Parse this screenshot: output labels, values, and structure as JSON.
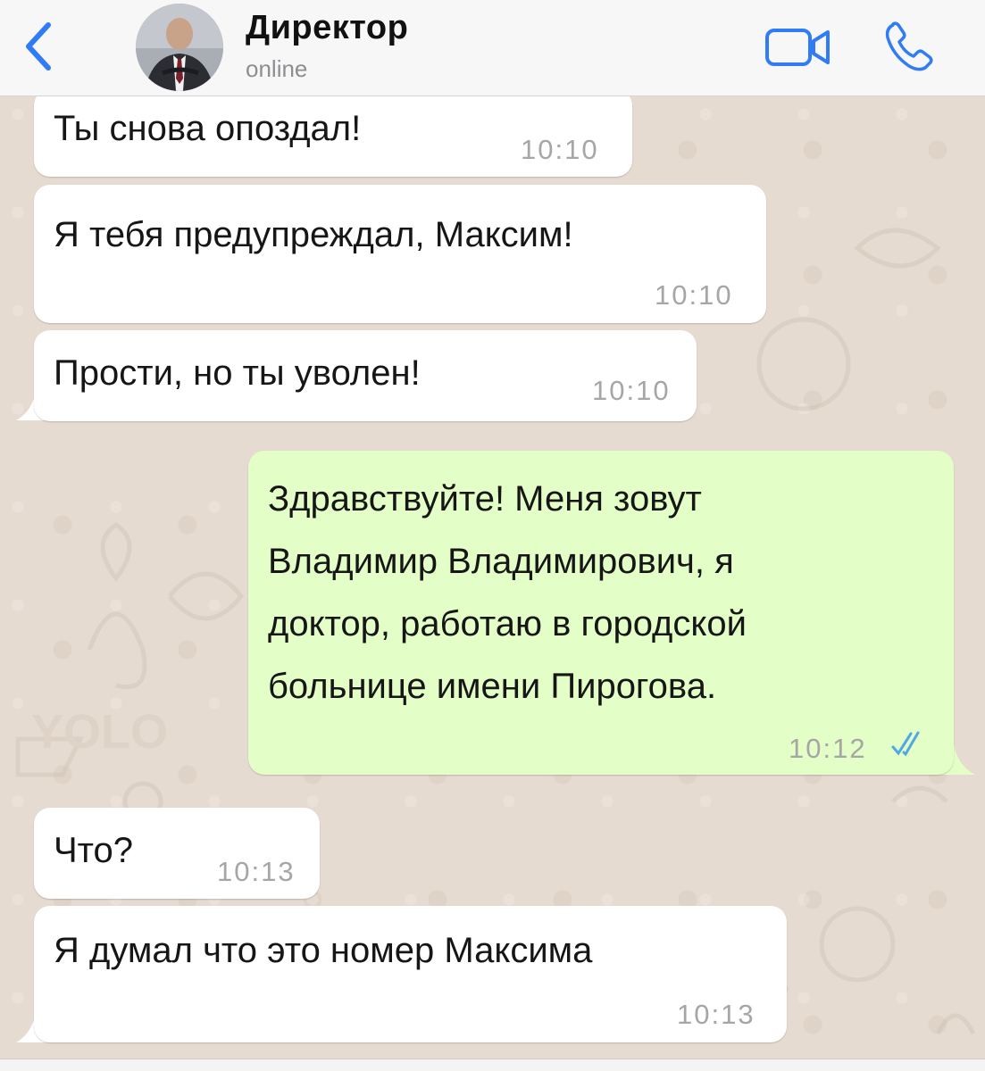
{
  "header": {
    "title": "Директор",
    "status": "online"
  },
  "colors": {
    "accent": "#2f7cf6",
    "incoming_bubble": "#ffffff",
    "outgoing_bubble": "#e3fec6",
    "read_ticks": "#4fa8e4"
  },
  "icons": [
    "chevron-left-icon",
    "video-camera-icon",
    "phone-icon",
    "double-check-icon"
  ],
  "messages": [
    {
      "direction": "in",
      "text": "Ты снова опоздал!",
      "time": "10:10"
    },
    {
      "direction": "in",
      "text": "Я тебя предупреждал, Максим!",
      "time": "10:10"
    },
    {
      "direction": "in",
      "text": "Прости, но ты уволен!",
      "time": "10:10"
    },
    {
      "direction": "out",
      "lines": [
        "Здравствуйте! Меня зовут",
        "Владимир Владимирович, я",
        "доктор, работаю  в городской",
        "больнице имени Пирогова."
      ],
      "time": "10:12",
      "read": true
    },
    {
      "direction": "in",
      "text": "Что?",
      "time": "10:13"
    },
    {
      "direction": "in",
      "text": "Я думал что это номер Максима",
      "time": "10:13"
    }
  ]
}
